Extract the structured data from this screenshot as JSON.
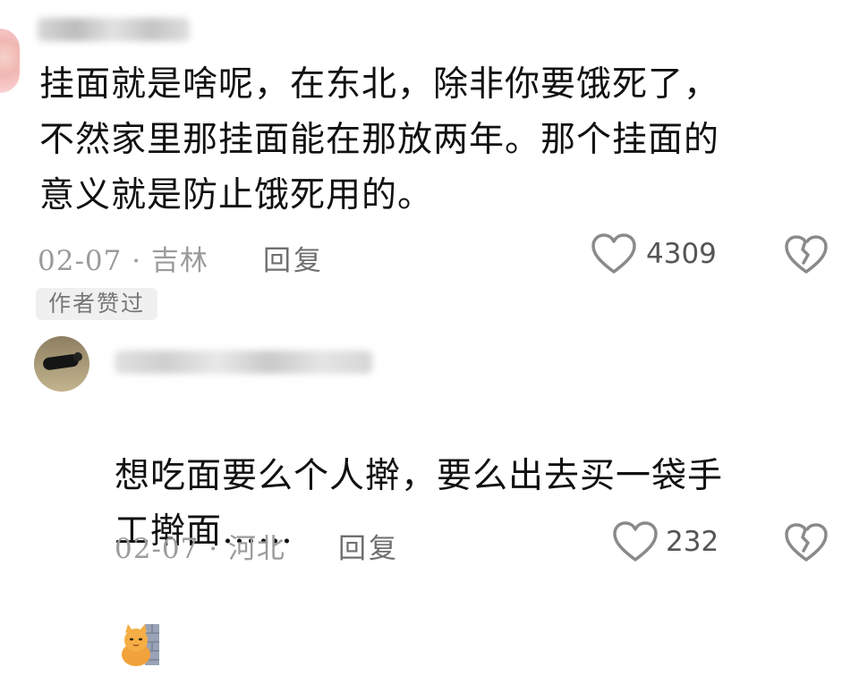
{
  "comments": [
    {
      "username": "",
      "text": "挂面就是啥呢，在东北，除非你要饿死了，\n不然家里那挂面能在那放两年。那个挂面的\n意义就是防止饿死用的。",
      "date_loc": "02-07 · 吉林",
      "reply_label": "回复",
      "likes": "4309",
      "author_badge": "作者赞过"
    },
    {
      "username": "",
      "text": "想吃面要么个人擀，要么出去买一袋手\n工擀面……",
      "date_loc": "02-07 · 河北",
      "reply_label": "回复",
      "likes": "232",
      "emoji_icon": "cat-at-wall-icon"
    }
  ],
  "colors": {
    "text": "#111111",
    "meta": "#9b9b9b",
    "icon": "#8a8a8a",
    "badge_bg": "#f0f0f0"
  }
}
